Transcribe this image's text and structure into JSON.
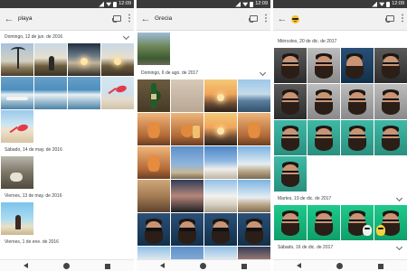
{
  "colors": {
    "statusbar": "#3a3a3a",
    "appbar": "#f1f1f1",
    "text": "#3c4043",
    "icon": "#5f6368"
  },
  "status": {
    "time": "12:09",
    "icons": [
      "signal-icon",
      "wifi-icon",
      "battery-icon"
    ]
  },
  "screens": [
    {
      "query": "playa",
      "query_type": "text",
      "sections": [
        {
          "date": "Domingo, 12 de jun. de 2016",
          "photos": [
            "beach-palm",
            "beach-sunset",
            "beach-dusk",
            "beach-sunset",
            "beach-surf",
            "beach-surf",
            "beach-surf",
            "beach-flag",
            "beach-sand"
          ]
        },
        {
          "date": "Sábado, 14 de may. de 2016",
          "photos": [
            "beach-dog"
          ]
        },
        {
          "date": "Viernes, 13 de may. de 2016",
          "photos": [
            "beach-woman"
          ]
        },
        {
          "date": "Viernes, 1 de ene. de 2016",
          "photos": []
        }
      ]
    },
    {
      "query": "Grecia",
      "query_type": "text",
      "sections": [
        {
          "date": "",
          "photos": [
            "gr-tree"
          ]
        },
        {
          "date": "Domingo, 6 de ago. de 2017",
          "photos": [
            "gr-beer",
            "gr-beer",
            "gr-sunset",
            "gr-sea",
            "gr-drink",
            "gr-drink",
            "gr-sunset",
            "gr-drink",
            "gr-drink",
            "gr-sky",
            "gr-mill",
            "gr-hill",
            "gr-wall",
            "gr-dusk",
            "gr-town",
            "gr-hill",
            "face-bg-blue",
            "face-bg-blue",
            "face-bg-blue",
            "face-bg-blue",
            "gr-town",
            "gr-sky",
            "gr-town",
            "gr-dusk"
          ]
        }
      ]
    },
    {
      "query": "😎",
      "query_type": "emoji",
      "sections": [
        {
          "date": "Miércoles, 20 de dic. de 2017",
          "photos": [
            "face-bg-dark",
            "face-bg-grey",
            "face-bg-blue",
            "face-bg-dark",
            "face-bg-dark",
            "face-bg-grey",
            "face-bg-grey",
            "face-bg-grey",
            "face-bg-teal",
            "face-bg-teal",
            "face-bg-teal",
            "face-bg-teal",
            "face-bg-teal"
          ]
        },
        {
          "date": "Martes, 19 de dic. de 2017",
          "photos": [
            "face-bg-green",
            "face-bg-green",
            "face-bg-green",
            "face-bg-green"
          ]
        },
        {
          "date": "Sábado, 16 de dic. de 2017",
          "photos": []
        }
      ]
    }
  ]
}
